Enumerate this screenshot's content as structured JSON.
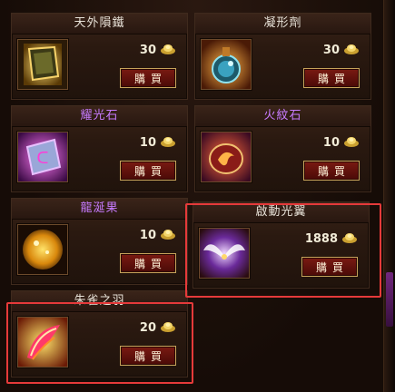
{
  "shop": {
    "items": [
      {
        "name": "天外隕鐵",
        "price": "30",
        "buy_label": "購買",
        "icon": "tome-icon"
      },
      {
        "name": "凝形劑",
        "price": "30",
        "buy_label": "購買",
        "icon": "potion-flask-icon"
      },
      {
        "name": "耀光石",
        "price": "10",
        "buy_label": "購買",
        "icon": "purple-gem-icon"
      },
      {
        "name": "火紋石",
        "price": "10",
        "buy_label": "購買",
        "icon": "fire-stone-icon"
      },
      {
        "name": "龍涎果",
        "price": "10",
        "buy_label": "購買",
        "icon": "dragon-fruit-icon"
      },
      {
        "name": "啟動光翼",
        "price": "1888",
        "buy_label": "購買",
        "icon": "light-wings-icon"
      },
      {
        "name": "朱雀之羽",
        "price": "20",
        "buy_label": "購買",
        "icon": "phoenix-feather-icon"
      }
    ],
    "currency_icon": "gold-ingot-icon",
    "colors": {
      "title_white": "#e8e2d8",
      "title_purple": "#c77bff",
      "button_red": "#7a1a12",
      "highlight_red": "#e53a3a"
    }
  }
}
